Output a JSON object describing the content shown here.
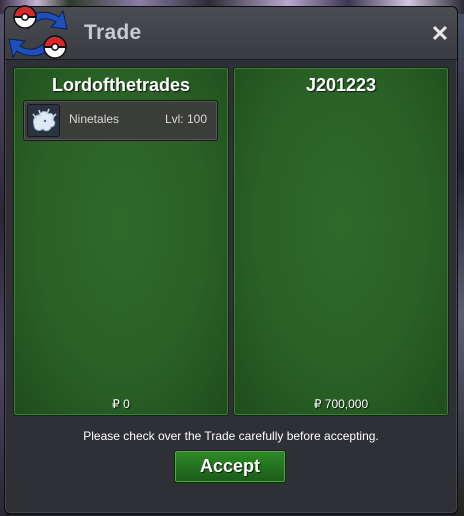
{
  "window": {
    "title": "Trade",
    "close_glyph": "✕",
    "logo_icon": "pokeball-trade-logo-icon"
  },
  "left_panel": {
    "player": "Lordofthetrades",
    "items": [
      {
        "icon": "ninetales-icon",
        "name": "Ninetales",
        "level": "Lvl: 100"
      }
    ],
    "money": "₽ 0"
  },
  "right_panel": {
    "player": "J201223",
    "items": [],
    "money": "₽ 700,000"
  },
  "footer": {
    "notice": "Please check over the Trade carefully before accepting.",
    "accept_label": "Accept"
  },
  "colors": {
    "panel_green": "#2a6126",
    "accept_green": "#237020",
    "dialog_bg": "#2e3036"
  }
}
